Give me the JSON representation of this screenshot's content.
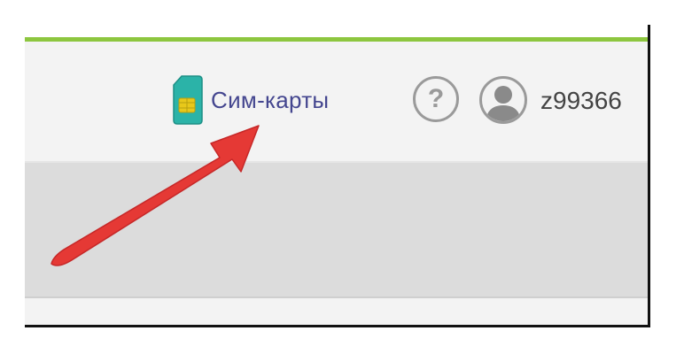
{
  "header": {
    "sim_cards_label": "Сим-карты",
    "help_symbol": "?",
    "username": "z99366"
  },
  "icons": {
    "sim": "sim-card-icon",
    "help": "help-icon",
    "avatar": "user-avatar-icon",
    "annotation": "red-arrow-annotation"
  },
  "colors": {
    "accent_green": "#8dc63f",
    "link_blue": "#44468f",
    "sim_teal": "#2bb3a8",
    "sim_chip": "#e8c81a",
    "annotation_red": "#e53935",
    "icon_gray": "#9a9a9a"
  }
}
